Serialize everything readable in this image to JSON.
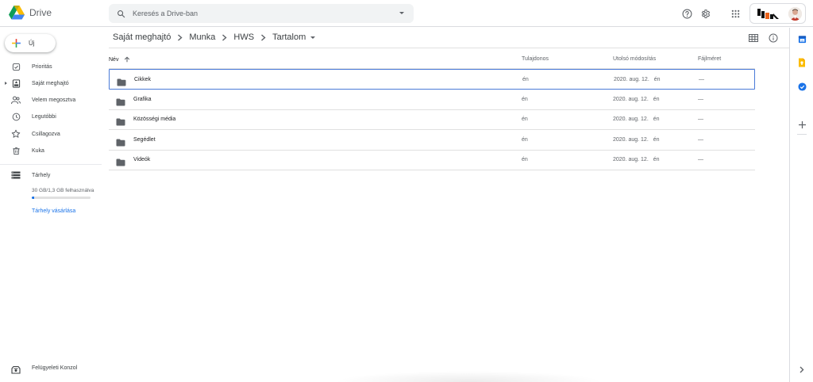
{
  "app": {
    "name": "Drive"
  },
  "search": {
    "placeholder": "Keresés a Drive-ban"
  },
  "new_button": {
    "label": "Új"
  },
  "sidebar": {
    "items": [
      {
        "label": "Prioritás",
        "icon": "priority-check-icon"
      },
      {
        "label": "Saját meghajtó",
        "icon": "my-drive-icon"
      },
      {
        "label": "Velem megosztva",
        "icon": "shared-with-me-icon"
      },
      {
        "label": "Legutóbbi",
        "icon": "recent-clock-icon"
      },
      {
        "label": "Csillagozva",
        "icon": "star-icon"
      },
      {
        "label": "Kuka",
        "icon": "trash-icon"
      }
    ],
    "storage": {
      "label": "Tárhely",
      "usage_text": "30 GB/1,3 GB felhasználva",
      "used_fraction": 0.043,
      "buy_link": "Tárhely vásárlása"
    },
    "admin": {
      "label": "Felügyeleti Konzol"
    }
  },
  "breadcrumb": {
    "items": [
      "Saját meghajtó",
      "Munka",
      "HWS",
      "Tartalom"
    ]
  },
  "table": {
    "columns": {
      "name": "Név",
      "owner": "Tulajdonos",
      "modified": "Utolsó módosítás",
      "size": "Fájlméret"
    },
    "rows": [
      {
        "name": "Cikkek",
        "owner": "én",
        "modified": "2020. aug. 12.",
        "modified_by": "én",
        "size": "—"
      },
      {
        "name": "Grafika",
        "owner": "én",
        "modified": "2020. aug. 12.",
        "modified_by": "én",
        "size": "—"
      },
      {
        "name": "Közösségi média",
        "owner": "én",
        "modified": "2020. aug. 12.",
        "modified_by": "én",
        "size": "—"
      },
      {
        "name": "Segédlet",
        "owner": "én",
        "modified": "2020. aug. 12.",
        "modified_by": "én",
        "size": "—"
      },
      {
        "name": "Videók",
        "owner": "én",
        "modified": "2020. aug. 12.",
        "modified_by": "én",
        "size": "—"
      }
    ]
  },
  "colors": {
    "accent": "#1a73e8",
    "selection_border": "#4a7ad8",
    "folder": "#5f6368",
    "text": "#202124",
    "muted": "#5f6368"
  }
}
